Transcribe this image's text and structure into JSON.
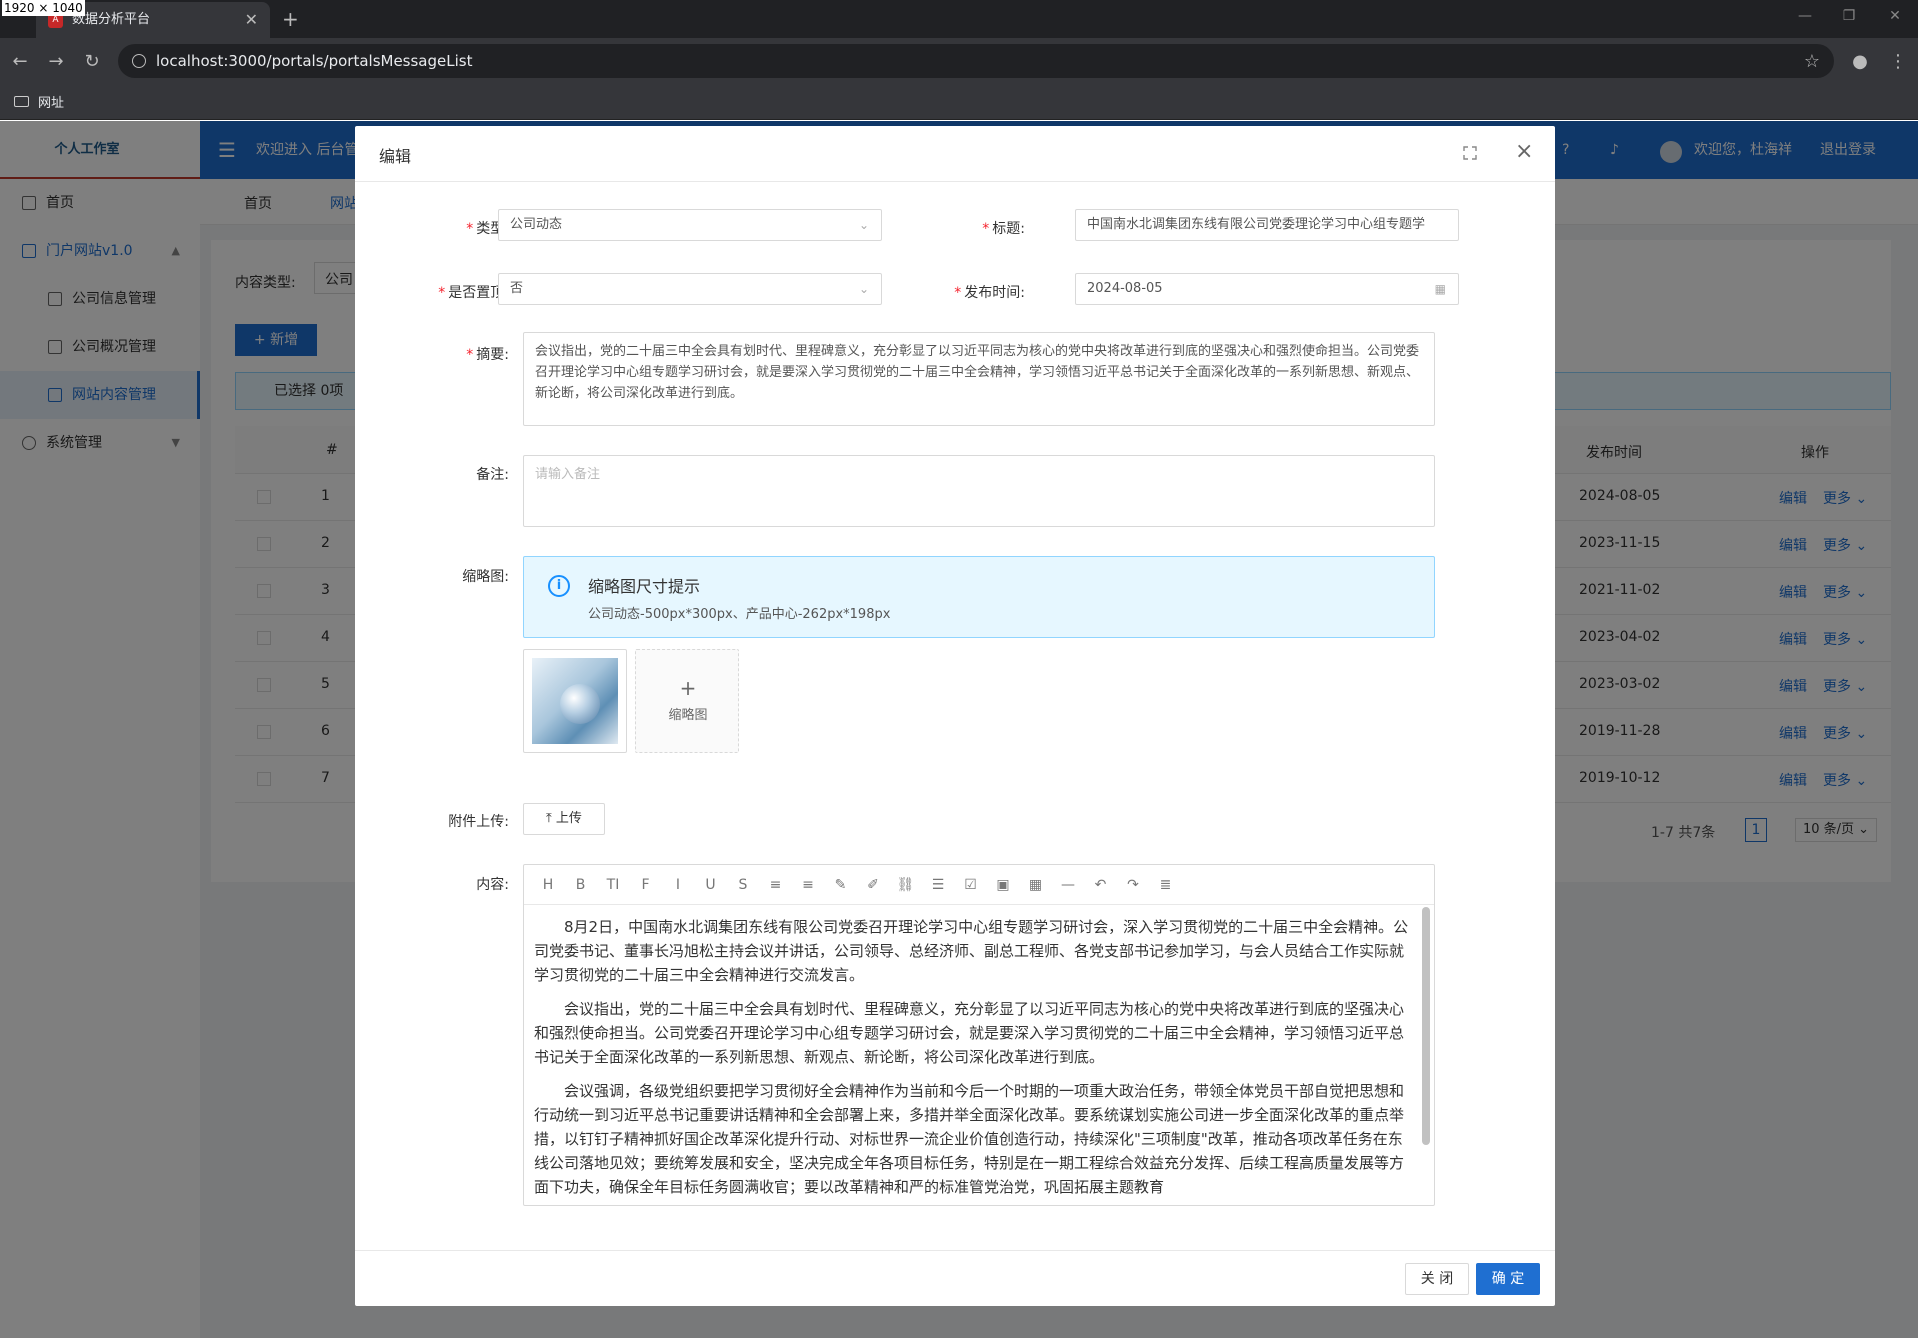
{
  "browser": {
    "dimensions_label": "1920 × 1040",
    "tab_title": "数据分析平台",
    "favicon_text": "A",
    "new_tab": "+",
    "url": "localhost:3000/portals/portalsMessageList",
    "bookmark_folder": "网址"
  },
  "app": {
    "logo_text": "个人工作室",
    "header_welcome": "欢迎进入 后台管",
    "user_greeting": "欢迎您，杜海祥",
    "logout": "退出登录",
    "menu": {
      "home": "首页",
      "portal": "门户网站v1.0",
      "company_info": "公司信息管理",
      "company_overview": "公司概况管理",
      "site_content": "网站内容管理",
      "system": "系统管理"
    },
    "tabs": [
      "首页",
      "网站"
    ],
    "filter_label": "内容类型:",
    "filter_value": "公司",
    "add_button": "+ 新增",
    "selected": "已选择 0项",
    "table_headers": {
      "index": "#",
      "date": "发布时间",
      "ops": "操作"
    },
    "rows": [
      {
        "n": "1",
        "date": "2024-08-05"
      },
      {
        "n": "2",
        "date": "2023-11-15"
      },
      {
        "n": "3",
        "date": "2021-11-02"
      },
      {
        "n": "4",
        "date": "2023-04-02"
      },
      {
        "n": "5",
        "date": "2023-03-02"
      },
      {
        "n": "6",
        "date": "2019-11-28"
      },
      {
        "n": "7",
        "date": "2019-10-12"
      }
    ],
    "row_edit": "编辑",
    "row_more": "更多 ⌄",
    "pagination": {
      "summary": "1-7 共7条",
      "page": "1",
      "size": "10 条/页 ⌄"
    }
  },
  "modal": {
    "title": "编辑",
    "type_label": "类型:",
    "type_value": "公司动态",
    "title_label": "标题:",
    "title_value": "中国南水北调集团东线有限公司党委理论学习中心组专题学",
    "pin_label": "是否置顶:",
    "pin_value": "否",
    "publish_label": "发布时间:",
    "publish_value": "2024-08-05",
    "summary_label": "摘要:",
    "summary_value": "会议指出，党的二十届三中全会具有划时代、里程碑意义，充分彰显了以习近平同志为核心的党中央将改革进行到底的坚强决心和强烈使命担当。公司党委召开理论学习中心组专题学习研讨会，就是要深入学习贯彻党的二十届三中全会精神，学习领悟习近平总书记关于全面深化改革的一系列新思想、新观点、新论断，将公司深化改革进行到底。",
    "remark_label": "备注:",
    "remark_placeholder": "请输入备注",
    "thumb_label": "缩略图:",
    "tip_title": "缩略图尺寸提示",
    "tip_desc": "公司动态-500px*300px、产品中心-262px*198px",
    "add_thumb_plus": "+",
    "add_thumb_text": "缩略图",
    "attach_label": "附件上传:",
    "upload_button": "⤒ 上传",
    "content_label": "内容:",
    "toolbar": [
      "H",
      "B",
      "TI",
      "F",
      "I",
      "U",
      "S",
      "≡",
      "≡",
      "✎",
      "✐",
      "⛓",
      "☰",
      "☑",
      "▣",
      "▦",
      "—",
      "↶",
      "↷",
      "≣"
    ],
    "paragraphs": [
      "8月2日，中国南水北调集团东线有限公司党委召开理论学习中心组专题学习研讨会，深入学习贯彻党的二十届三中全会精神。公司党委书记、董事长冯旭松主持会议并讲话，公司领导、总经济师、副总工程师、各党支部书记参加学习，与会人员结合工作实际就学习贯彻党的二十届三中全会精神进行交流发言。",
      "会议指出，党的二十届三中全会具有划时代、里程碑意义，充分彰显了以习近平同志为核心的党中央将改革进行到底的坚强决心和强烈使命担当。公司党委召开理论学习中心组专题学习研讨会，就是要深入学习贯彻党的二十届三中全会精神，学习领悟习近平总书记关于全面深化改革的一系列新思想、新观点、新论断，将公司深化改革进行到底。",
      "会议强调，各级党组织要把学习贯彻好全会精神作为当前和今后一个时期的一项重大政治任务，带领全体党员干部自觉把思想和行动统一到习近平总书记重要讲话精神和全会部署上来，多措并举全面深化改革。要系统谋划实施公司进一步全面深化改革的重点举措，以钉钉子精神抓好国企改革深化提升行动、对标世界一流企业价值创造行动，持续深化\"三项制度\"改革，推动各项改革任务在东线公司落地见效；要统筹发展和安全，坚决完成全年各项目标任务，特别是在一期工程综合效益充分发挥、后续工程高质量发展等方面下功夫，确保全年目标任务圆满收官；要以改革精神和严的标准管党治党，巩固拓展主题教育"
    ],
    "close_button": "关 闭",
    "ok_button": "确 定"
  },
  "colors": {
    "primary": "#1f6fd1",
    "required": "#f5222d",
    "tip_bg": "#e6f7ff"
  }
}
